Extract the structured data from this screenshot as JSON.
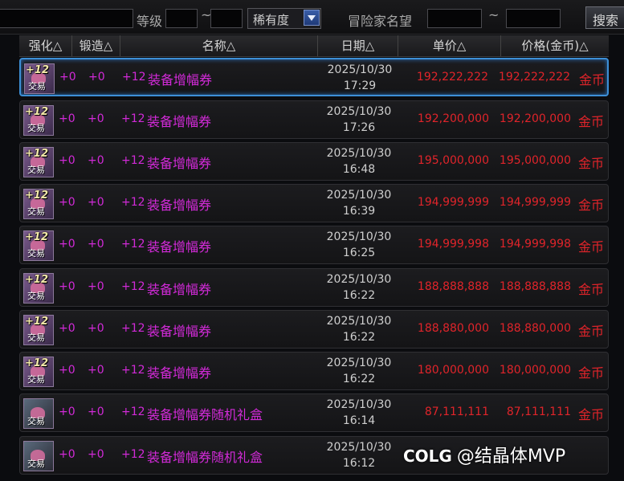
{
  "filters": {
    "level_label": "等级",
    "tilde": "~",
    "rarity_label": "稀有度",
    "adventurer_label": "冒险家名望",
    "search_label": "搜索"
  },
  "columns": {
    "reinforce": "强化△",
    "forge": "锻造△",
    "name": "名称△",
    "date": "日期△",
    "unit_price": "单价△",
    "price_gold": "价格(金币)△"
  },
  "currency_label": "金币",
  "icon_badge": "+12",
  "icon_trade": "交易",
  "rows": [
    {
      "reinforce": "+0",
      "forge": "+0",
      "plus": "+12",
      "name": "装备增幅券",
      "date": "2025/10/30",
      "time": "17:29",
      "unit": "192,222,222",
      "price": "192,222,222",
      "icon": "amplify-ticket-icon"
    },
    {
      "reinforce": "+0",
      "forge": "+0",
      "plus": "+12",
      "name": "装备增幅券",
      "date": "2025/10/30",
      "time": "17:26",
      "unit": "192,200,000",
      "price": "192,200,000",
      "icon": "amplify-ticket-icon"
    },
    {
      "reinforce": "+0",
      "forge": "+0",
      "plus": "+12",
      "name": "装备增幅券",
      "date": "2025/10/30",
      "time": "16:48",
      "unit": "195,000,000",
      "price": "195,000,000",
      "icon": "amplify-ticket-icon"
    },
    {
      "reinforce": "+0",
      "forge": "+0",
      "plus": "+12",
      "name": "装备增幅券",
      "date": "2025/10/30",
      "time": "16:39",
      "unit": "194,999,999",
      "price": "194,999,999",
      "icon": "amplify-ticket-icon"
    },
    {
      "reinforce": "+0",
      "forge": "+0",
      "plus": "+12",
      "name": "装备增幅券",
      "date": "2025/10/30",
      "time": "16:25",
      "unit": "194,999,998",
      "price": "194,999,998",
      "icon": "amplify-ticket-icon"
    },
    {
      "reinforce": "+0",
      "forge": "+0",
      "plus": "+12",
      "name": "装备增幅券",
      "date": "2025/10/30",
      "time": "16:22",
      "unit": "188,888,888",
      "price": "188,888,888",
      "icon": "amplify-ticket-icon"
    },
    {
      "reinforce": "+0",
      "forge": "+0",
      "plus": "+12",
      "name": "装备增幅券",
      "date": "2025/10/30",
      "time": "16:22",
      "unit": "188,880,000",
      "price": "188,880,000",
      "icon": "amplify-ticket-icon"
    },
    {
      "reinforce": "+0",
      "forge": "+0",
      "plus": "+12",
      "name": "装备增幅券",
      "date": "2025/10/30",
      "time": "16:22",
      "unit": "180,000,000",
      "price": "180,000,000",
      "icon": "amplify-ticket-icon"
    },
    {
      "reinforce": "+0",
      "forge": "+0",
      "plus": "+12",
      "name": "装备增幅券随机礼盒",
      "date": "2025/10/30",
      "time": "16:14",
      "unit": "87,111,111",
      "price": "87,111,111",
      "icon": "gift-box-icon"
    },
    {
      "reinforce": "+0",
      "forge": "+0",
      "plus": "+12",
      "name": "装备增幅券随机礼盒",
      "date": "2025/10/30",
      "time": "16:12",
      "unit": "",
      "price": "",
      "icon": "gift-box-icon"
    }
  ],
  "watermark": {
    "logo": "COLG",
    "text": "@结晶体MVP"
  },
  "colors": {
    "accent_name": "#d22ad8",
    "price": "#e0242a",
    "selected_border": "#3d8fd6"
  }
}
